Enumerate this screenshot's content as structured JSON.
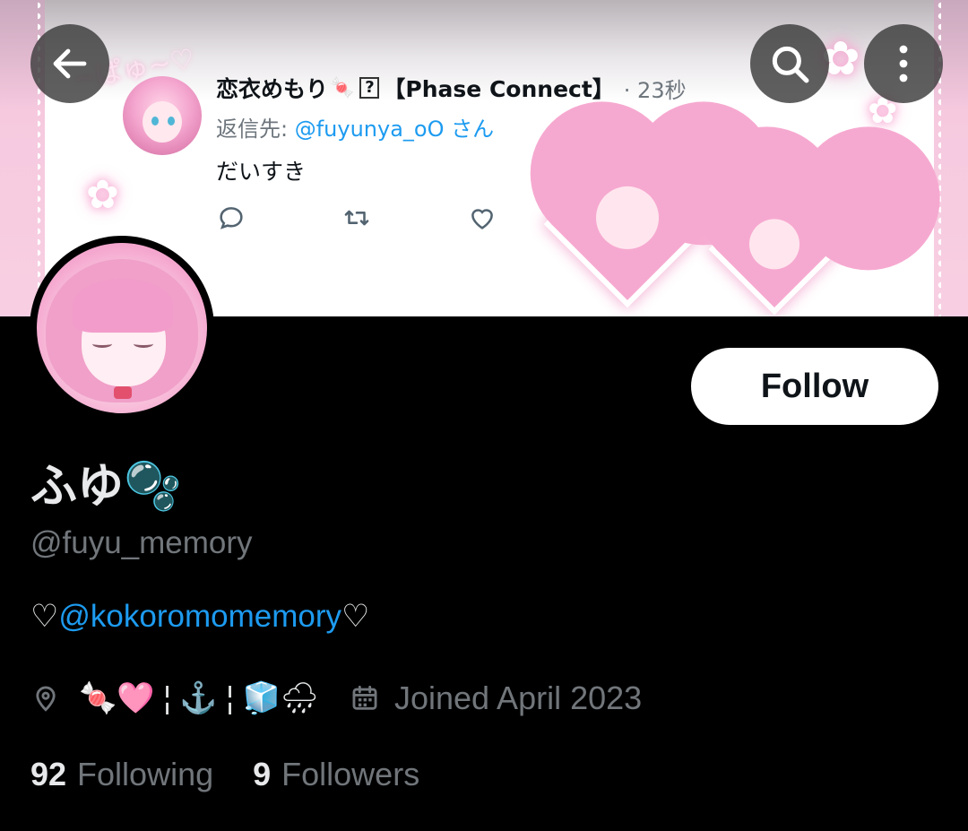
{
  "banner_tweet": {
    "author_name": "恋衣めもり",
    "author_emoji": "🍬",
    "unknown_glyph": "?",
    "group_tag": "【Phase Connect】",
    "time": "· 23秒",
    "reply_prefix": "返信先:",
    "reply_handle": "@fuyunya_oO",
    "reply_suffix": "さん",
    "text": "だいすき",
    "decor_text": "~ぱゅ~♡"
  },
  "toolbar": {
    "back_icon": "arrow-left-icon",
    "search_icon": "search-icon",
    "more_icon": "more-vertical-icon"
  },
  "profile": {
    "display_name": "ふゆ🫧",
    "handle": "@fuyu_memory",
    "bio_prefix": "♡",
    "bio_mention": "@kokoromomemory",
    "bio_suffix": "♡",
    "location": "🍬🩷 ¦ ⚓ ¦ 🧊🌧",
    "joined": "Joined April 2023",
    "following_count": "92",
    "following_label": "Following",
    "followers_count": "9",
    "followers_label": "Followers",
    "follow_button": "Follow"
  },
  "colors": {
    "background": "#000000",
    "accent": "#1d9bf0",
    "secondary_text": "#71767b",
    "primary_text": "#e7e9ea"
  }
}
